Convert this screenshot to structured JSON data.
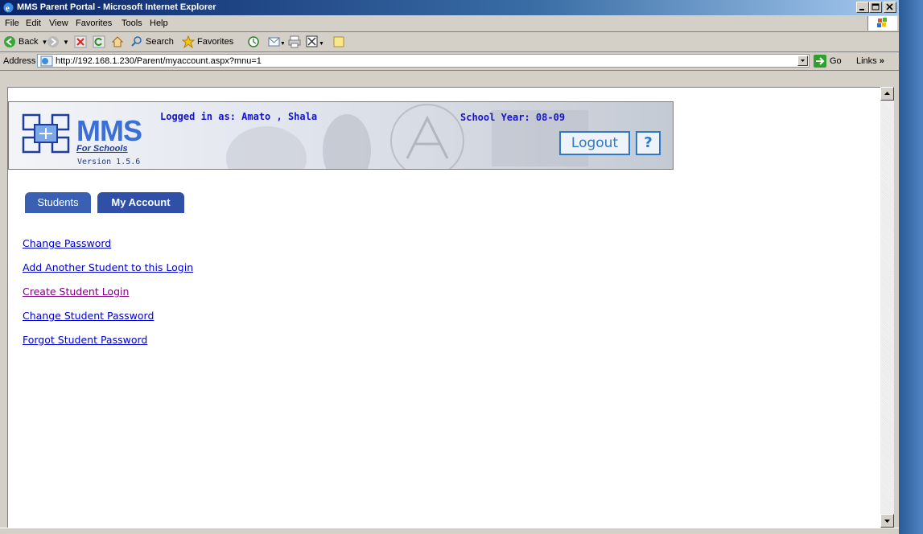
{
  "window": {
    "title": "MMS Parent Portal - Microsoft Internet Explorer"
  },
  "menu": [
    {
      "label": "File",
      "key": "F"
    },
    {
      "label": "Edit",
      "key": "E"
    },
    {
      "label": "View",
      "key": "V"
    },
    {
      "label": "Favorites",
      "key": "a"
    },
    {
      "label": "Tools",
      "key": "T"
    },
    {
      "label": "Help",
      "key": "H"
    }
  ],
  "toolbar": {
    "back_label": "Back",
    "search_label": "Search",
    "favorites_label": "Favorites"
  },
  "address": {
    "label": "Address",
    "url": "http://192.168.1.230/Parent/myaccount.aspx?mnu=1",
    "go_label": "Go",
    "links_label": "Links"
  },
  "header": {
    "logo_text": "MMS",
    "logo_sub": "For Schools",
    "version": "Version 1.5.6",
    "logged_in": "Logged in as: Amato , Shala",
    "school_year": "School Year: 08-09",
    "logout_label": "Logout",
    "help_label": "?"
  },
  "tabs": [
    {
      "label": "Students"
    },
    {
      "label": "My Account"
    }
  ],
  "links": [
    {
      "label": "Change Password"
    },
    {
      "label": "Add Another Student to this Login"
    },
    {
      "label": "Create Student Login"
    },
    {
      "label": "Change Student Password"
    },
    {
      "label": "Forgot Student Password"
    }
  ],
  "colors": {
    "link": "#0000cc",
    "visited": "#800080",
    "tab": "#3a60b4",
    "brand": "#3a6fd8"
  }
}
